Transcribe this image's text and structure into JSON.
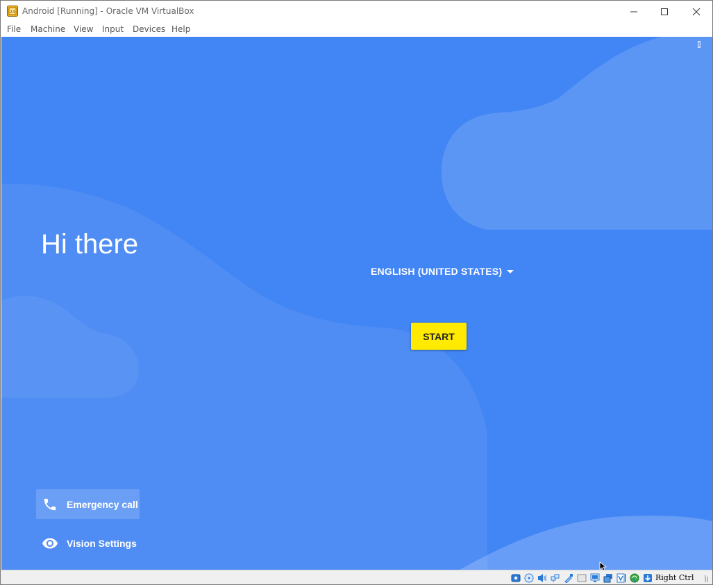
{
  "window": {
    "title": "Android [Running] - Oracle VM VirtualBox",
    "controls": {
      "minimize_icon": "minimize-icon",
      "maximize_icon": "maximize-icon",
      "close_icon": "close-icon"
    }
  },
  "menubar": {
    "items": [
      "File",
      "Machine",
      "View",
      "Input",
      "Devices",
      "Help"
    ]
  },
  "android": {
    "greeting": "Hi there",
    "language_selector": "ENGLISH (UNITED STATES)",
    "start_button": "START",
    "emergency_call": "Emergency call",
    "vision_settings": "Vision Settings",
    "colors": {
      "background": "#4285f4",
      "start_button_bg": "#ffea00",
      "text": "#ffffff"
    }
  },
  "statusbar": {
    "host_key": "Right Ctrl",
    "icons": [
      "hard-disk-icon",
      "optical-drive-icon",
      "audio-icon",
      "network-icon",
      "usb-icon",
      "shared-folders-icon",
      "display-icon",
      "video-capture-icon",
      "virtualization-icon",
      "mouse-integration-icon",
      "keyboard-capture-icon"
    ]
  }
}
